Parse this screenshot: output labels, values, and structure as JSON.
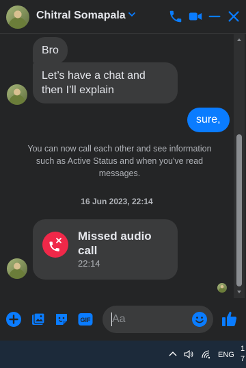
{
  "header": {
    "contact_name": "Chitral Somapala",
    "icons": [
      "chevron-down-icon",
      "phone-icon",
      "video-icon",
      "minimize-icon",
      "close-icon"
    ]
  },
  "messages": {
    "incoming_1": "Bro",
    "incoming_2_line1": "Let’s have a chat and",
    "incoming_2_line2": "then I’ll explain",
    "outgoing_1": "sure,"
  },
  "system_notice": {
    "line1": "You can now call each other and see information",
    "line2": "such as Active Status and when you've read",
    "line3": "messages."
  },
  "timestamp": "16 Jun 2023, 22:14",
  "missed_call": {
    "title_line1": "Missed audio",
    "title_line2": "call",
    "time": "22:14"
  },
  "composer": {
    "placeholder": "Aa",
    "icons": [
      "add-icon",
      "image-icon",
      "sticker-icon",
      "gif-icon",
      "emoji-icon",
      "like-icon"
    ]
  },
  "taskbar": {
    "language": "ENG",
    "clock_line1": "1",
    "clock_line2": "7"
  },
  "colors": {
    "background": "#242526",
    "bubble_incoming": "#3a3b3c",
    "bubble_outgoing": "#0a7cff",
    "accent": "#0a7cff",
    "missed_call": "#f02849"
  }
}
